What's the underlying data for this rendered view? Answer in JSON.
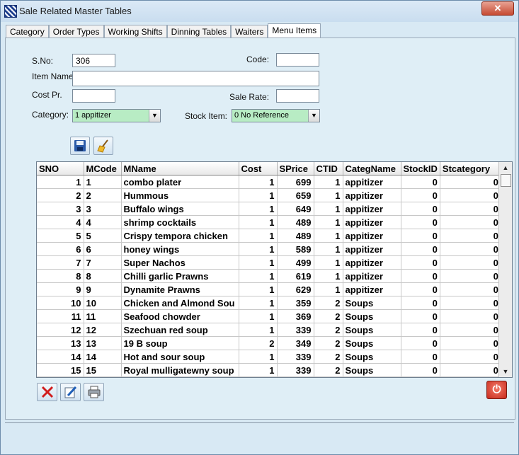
{
  "window": {
    "title": "Sale Related Master Tables",
    "close_label": "✕"
  },
  "tabs": [
    {
      "label": "Category"
    },
    {
      "label": "Order Types"
    },
    {
      "label": "Working Shifts"
    },
    {
      "label": "Dinning Tables"
    },
    {
      "label": "Waiters"
    },
    {
      "label": "Menu Items",
      "active": true
    }
  ],
  "form": {
    "sno_label": "S.No:",
    "sno_value": "306",
    "code_label": "Code:",
    "code_value": "",
    "item_name_label": "Item Name:",
    "item_name_value": "",
    "cost_label": "Cost Pr.",
    "cost_value": "",
    "sale_rate_label": "Sale Rate:",
    "sale_rate_value": "",
    "category_label": "Category:",
    "category_value": "1      appitizer",
    "stock_item_label": "Stock Item:",
    "stock_item_value": "0   No Reference"
  },
  "grid": {
    "columns": [
      "SNO",
      "MCode",
      "MName",
      "Cost",
      "SPrice",
      "CTID",
      "CategName",
      "StockID",
      "Stcategory"
    ],
    "rows": [
      [
        "1",
        "1",
        "combo plater",
        "1",
        "699",
        "1",
        "appitizer",
        "0",
        "0"
      ],
      [
        "2",
        "2",
        "Hummous",
        "1",
        "659",
        "1",
        "appitizer",
        "0",
        "0"
      ],
      [
        "3",
        "3",
        "Buffalo wings",
        "1",
        "649",
        "1",
        "appitizer",
        "0",
        "0"
      ],
      [
        "4",
        "4",
        "shrimp cocktails",
        "1",
        "489",
        "1",
        "appitizer",
        "0",
        "0"
      ],
      [
        "5",
        "5",
        "Crispy tempora chicken",
        "1",
        "489",
        "1",
        "appitizer",
        "0",
        "0"
      ],
      [
        "6",
        "6",
        "honey wings",
        "1",
        "589",
        "1",
        "appitizer",
        "0",
        "0"
      ],
      [
        "7",
        "7",
        "Super Nachos",
        "1",
        "499",
        "1",
        "appitizer",
        "0",
        "0"
      ],
      [
        "8",
        "8",
        "Chilli garlic Prawns",
        "1",
        "619",
        "1",
        "appitizer",
        "0",
        "0"
      ],
      [
        "9",
        "9",
        "Dynamite Prawns",
        "1",
        "629",
        "1",
        "appitizer",
        "0",
        "0"
      ],
      [
        "10",
        "10",
        "Chicken and Almond Sou",
        "1",
        "359",
        "2",
        "Soups",
        "0",
        "0"
      ],
      [
        "11",
        "11",
        "Seafood chowder",
        "1",
        "369",
        "2",
        "Soups",
        "0",
        "0"
      ],
      [
        "12",
        "12",
        "Szechuan red soup",
        "1",
        "339",
        "2",
        "Soups",
        "0",
        "0"
      ],
      [
        "13",
        "13",
        "19 B soup",
        "2",
        "349",
        "2",
        "Soups",
        "0",
        "0"
      ],
      [
        "14",
        "14",
        "Hot and sour soup",
        "1",
        "339",
        "2",
        "Soups",
        "0",
        "0"
      ],
      [
        "15",
        "15",
        "Royal mulligatewny soup",
        "1",
        "339",
        "2",
        "Soups",
        "0",
        "0"
      ]
    ]
  },
  "icons": {
    "save": "floppy-disk-icon",
    "clear": "broom-icon",
    "delete": "red-x-icon",
    "edit": "pencil-icon",
    "print": "printer-icon",
    "exit": "power-icon"
  }
}
